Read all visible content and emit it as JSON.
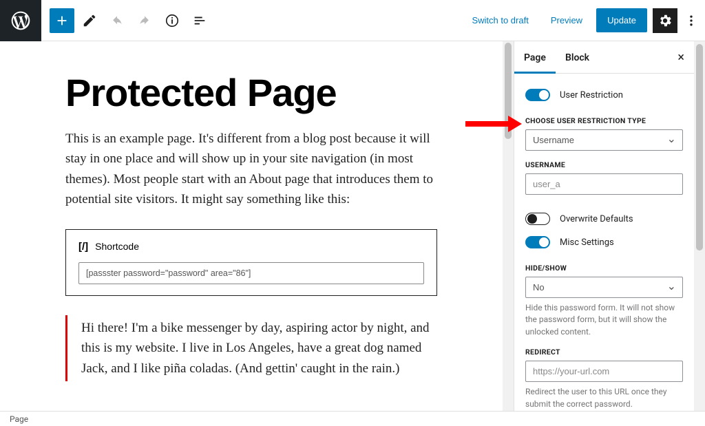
{
  "toolbar": {
    "switch_draft": "Switch to draft",
    "preview": "Preview",
    "update": "Update"
  },
  "editor": {
    "title": "Protected Page",
    "intro": "This is an example page. It's different from a blog post because it will stay in one place and will show up in your site navigation (in most themes). Most people start with an About page that introduces them to potential site visitors. It might say something like this:",
    "shortcode_label": "Shortcode",
    "shortcode_value": "[passster password=\"password\" area=\"86\"]",
    "quote": "Hi there! I'm a bike messenger by day, aspiring actor by night, and this is my website. I live in Los Angeles, have a great dog named Jack, and I like piña coladas. (And gettin' caught in the rain.)"
  },
  "sidebar": {
    "tabs": {
      "page": "Page",
      "block": "Block"
    },
    "user_restriction_label": "User Restriction",
    "choose_type_label": "CHOOSE USER RESTRICTION TYPE",
    "choose_type_value": "Username",
    "username_label": "USERNAME",
    "username_placeholder": "user_a",
    "overwrite_label": "Overwrite Defaults",
    "misc_label": "Misc Settings",
    "hideshow_label": "HIDE/SHOW",
    "hideshow_value": "No",
    "hideshow_help": "Hide this password form. It will not show the password form, but it will show the unlocked content.",
    "redirect_label": "REDIRECT",
    "redirect_placeholder": "https://your-url.com",
    "redirect_help": "Redirect the user to this URL once they submit the correct password."
  },
  "footer": {
    "breadcrumb": "Page"
  }
}
